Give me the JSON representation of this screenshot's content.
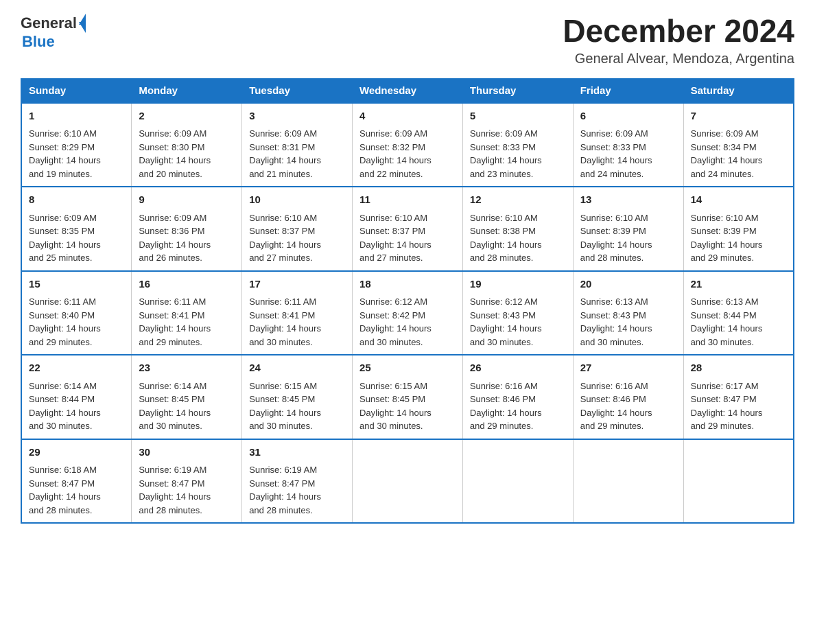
{
  "header": {
    "logo": {
      "general": "General",
      "blue": "Blue"
    },
    "title": "December 2024",
    "subtitle": "General Alvear, Mendoza, Argentina"
  },
  "days_of_week": [
    "Sunday",
    "Monday",
    "Tuesday",
    "Wednesday",
    "Thursday",
    "Friday",
    "Saturday"
  ],
  "weeks": [
    [
      {
        "day": "1",
        "sunrise": "6:10 AM",
        "sunset": "8:29 PM",
        "daylight": "14 hours and 19 minutes."
      },
      {
        "day": "2",
        "sunrise": "6:09 AM",
        "sunset": "8:30 PM",
        "daylight": "14 hours and 20 minutes."
      },
      {
        "day": "3",
        "sunrise": "6:09 AM",
        "sunset": "8:31 PM",
        "daylight": "14 hours and 21 minutes."
      },
      {
        "day": "4",
        "sunrise": "6:09 AM",
        "sunset": "8:32 PM",
        "daylight": "14 hours and 22 minutes."
      },
      {
        "day": "5",
        "sunrise": "6:09 AM",
        "sunset": "8:33 PM",
        "daylight": "14 hours and 23 minutes."
      },
      {
        "day": "6",
        "sunrise": "6:09 AM",
        "sunset": "8:33 PM",
        "daylight": "14 hours and 24 minutes."
      },
      {
        "day": "7",
        "sunrise": "6:09 AM",
        "sunset": "8:34 PM",
        "daylight": "14 hours and 24 minutes."
      }
    ],
    [
      {
        "day": "8",
        "sunrise": "6:09 AM",
        "sunset": "8:35 PM",
        "daylight": "14 hours and 25 minutes."
      },
      {
        "day": "9",
        "sunrise": "6:09 AM",
        "sunset": "8:36 PM",
        "daylight": "14 hours and 26 minutes."
      },
      {
        "day": "10",
        "sunrise": "6:10 AM",
        "sunset": "8:37 PM",
        "daylight": "14 hours and 27 minutes."
      },
      {
        "day": "11",
        "sunrise": "6:10 AM",
        "sunset": "8:37 PM",
        "daylight": "14 hours and 27 minutes."
      },
      {
        "day": "12",
        "sunrise": "6:10 AM",
        "sunset": "8:38 PM",
        "daylight": "14 hours and 28 minutes."
      },
      {
        "day": "13",
        "sunrise": "6:10 AM",
        "sunset": "8:39 PM",
        "daylight": "14 hours and 28 minutes."
      },
      {
        "day": "14",
        "sunrise": "6:10 AM",
        "sunset": "8:39 PM",
        "daylight": "14 hours and 29 minutes."
      }
    ],
    [
      {
        "day": "15",
        "sunrise": "6:11 AM",
        "sunset": "8:40 PM",
        "daylight": "14 hours and 29 minutes."
      },
      {
        "day": "16",
        "sunrise": "6:11 AM",
        "sunset": "8:41 PM",
        "daylight": "14 hours and 29 minutes."
      },
      {
        "day": "17",
        "sunrise": "6:11 AM",
        "sunset": "8:41 PM",
        "daylight": "14 hours and 30 minutes."
      },
      {
        "day": "18",
        "sunrise": "6:12 AM",
        "sunset": "8:42 PM",
        "daylight": "14 hours and 30 minutes."
      },
      {
        "day": "19",
        "sunrise": "6:12 AM",
        "sunset": "8:43 PM",
        "daylight": "14 hours and 30 minutes."
      },
      {
        "day": "20",
        "sunrise": "6:13 AM",
        "sunset": "8:43 PM",
        "daylight": "14 hours and 30 minutes."
      },
      {
        "day": "21",
        "sunrise": "6:13 AM",
        "sunset": "8:44 PM",
        "daylight": "14 hours and 30 minutes."
      }
    ],
    [
      {
        "day": "22",
        "sunrise": "6:14 AM",
        "sunset": "8:44 PM",
        "daylight": "14 hours and 30 minutes."
      },
      {
        "day": "23",
        "sunrise": "6:14 AM",
        "sunset": "8:45 PM",
        "daylight": "14 hours and 30 minutes."
      },
      {
        "day": "24",
        "sunrise": "6:15 AM",
        "sunset": "8:45 PM",
        "daylight": "14 hours and 30 minutes."
      },
      {
        "day": "25",
        "sunrise": "6:15 AM",
        "sunset": "8:45 PM",
        "daylight": "14 hours and 30 minutes."
      },
      {
        "day": "26",
        "sunrise": "6:16 AM",
        "sunset": "8:46 PM",
        "daylight": "14 hours and 29 minutes."
      },
      {
        "day": "27",
        "sunrise": "6:16 AM",
        "sunset": "8:46 PM",
        "daylight": "14 hours and 29 minutes."
      },
      {
        "day": "28",
        "sunrise": "6:17 AM",
        "sunset": "8:47 PM",
        "daylight": "14 hours and 29 minutes."
      }
    ],
    [
      {
        "day": "29",
        "sunrise": "6:18 AM",
        "sunset": "8:47 PM",
        "daylight": "14 hours and 28 minutes."
      },
      {
        "day": "30",
        "sunrise": "6:19 AM",
        "sunset": "8:47 PM",
        "daylight": "14 hours and 28 minutes."
      },
      {
        "day": "31",
        "sunrise": "6:19 AM",
        "sunset": "8:47 PM",
        "daylight": "14 hours and 28 minutes."
      },
      null,
      null,
      null,
      null
    ]
  ],
  "labels": {
    "sunrise": "Sunrise:",
    "sunset": "Sunset:",
    "daylight": "Daylight:"
  }
}
